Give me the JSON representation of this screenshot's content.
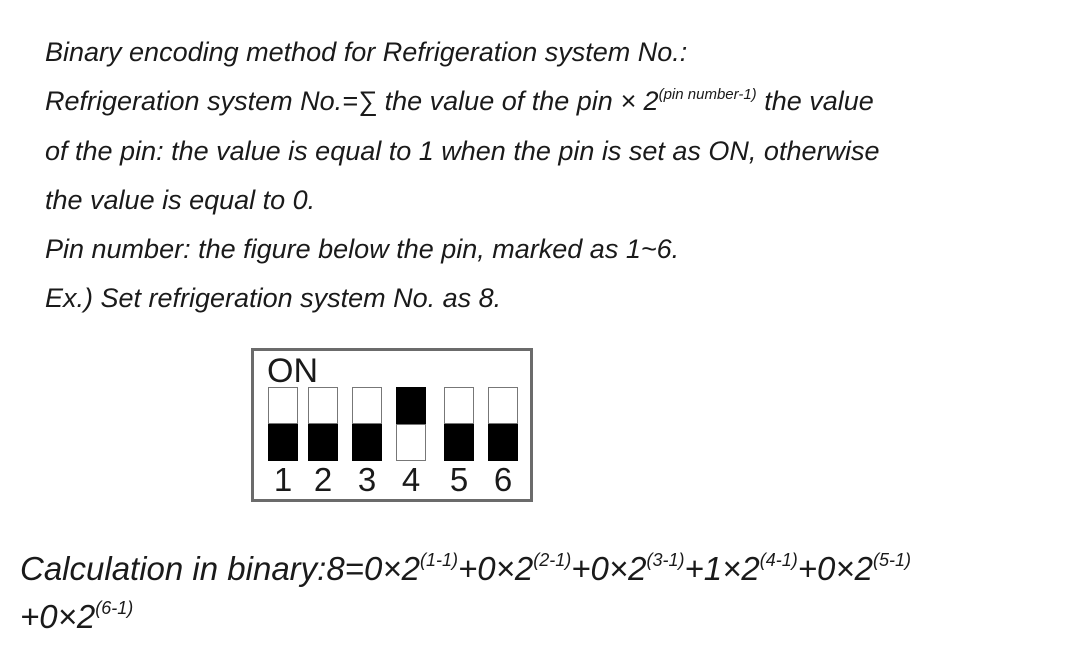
{
  "document": {
    "lines": [
      "Binary encoding method for Refrigeration system No.:",
      null,
      "of the pin: the value is equal to 1 when the pin is set as ON, otherwise",
      "the value is equal to 0.",
      "Pin number: the figure below the pin, marked as 1~6.",
      "Ex.) Set refrigeration system No. as 8."
    ],
    "formula": {
      "before": "Refrigeration system No.=∑ the value of the pin × 2",
      "exponent": "(pin number-1)",
      "after": " the value"
    }
  },
  "dip_switch": {
    "on_label": "ON",
    "pins": [
      {
        "number": "1",
        "state": "off"
      },
      {
        "number": "2",
        "state": "off"
      },
      {
        "number": "3",
        "state": "off"
      },
      {
        "number": "4",
        "state": "on"
      },
      {
        "number": "5",
        "state": "off"
      },
      {
        "number": "6",
        "state": "off"
      }
    ]
  },
  "calculation": {
    "prefix": "Calculation in binary:8=",
    "terms": [
      {
        "coef": "0×2",
        "exp": "(1-1)"
      },
      {
        "coef": "+0×2",
        "exp": "(2-1)"
      },
      {
        "coef": "+0×2",
        "exp": "(3-1)"
      },
      {
        "coef": "+1×2",
        "exp": "(4-1)"
      },
      {
        "coef": "+0×2",
        "exp": "(5-1)"
      },
      {
        "coef": "+0×2",
        "exp": "(6-1)"
      }
    ]
  }
}
